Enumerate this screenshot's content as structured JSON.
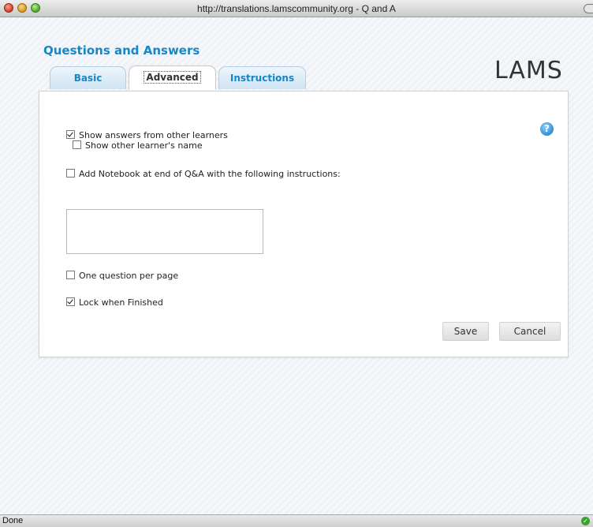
{
  "window": {
    "title": "http://translations.lamscommunity.org - Q and A"
  },
  "page": {
    "heading": "Questions and Answers",
    "logo": "LAMS"
  },
  "tabs": [
    {
      "label": "Basic",
      "active": false
    },
    {
      "label": "Advanced",
      "active": true
    },
    {
      "label": "Instructions",
      "active": false
    }
  ],
  "help": {
    "symbol": "?"
  },
  "options": {
    "show_answers": {
      "label": "Show answers from other learners",
      "checked": true
    },
    "show_name": {
      "label": "Show other learner's name",
      "checked": false
    },
    "add_notebook": {
      "label": "Add Notebook at end of Q&A with the following instructions:",
      "checked": false
    },
    "notebook_instructions": {
      "value": "",
      "placeholder": ""
    },
    "one_question": {
      "label": "One question per page",
      "checked": false
    },
    "lock_finished": {
      "label": "Lock when Finished",
      "checked": true
    }
  },
  "buttons": {
    "save": "Save",
    "cancel": "Cancel"
  },
  "statusbar": {
    "text": "Done",
    "icon": "secure-check-icon"
  }
}
